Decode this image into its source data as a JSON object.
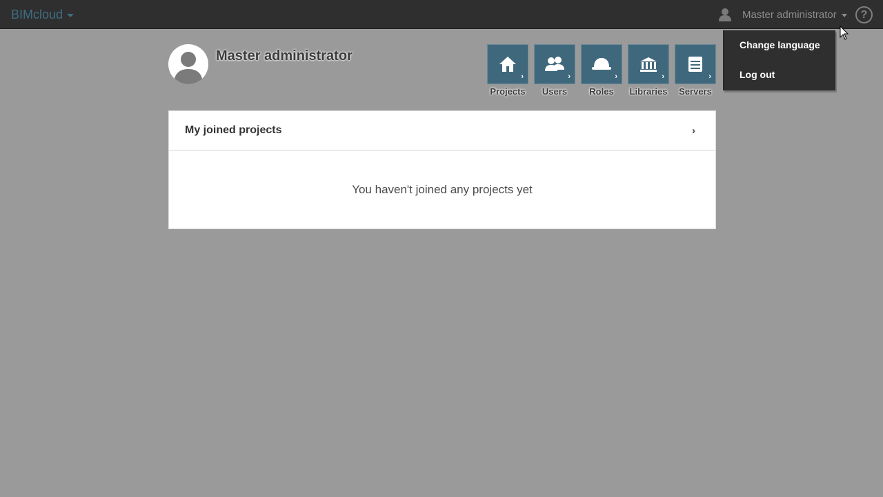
{
  "app": {
    "brand": "BIMcloud",
    "accent_color": "#3f6d82"
  },
  "topbar": {
    "user_name": "Master administrator",
    "help_glyph": "?"
  },
  "profile": {
    "name": "Master administrator",
    "avatar_icon": "user-avatar-icon"
  },
  "tiles": [
    {
      "label": "Projects",
      "icon": "house-icon"
    },
    {
      "label": "Users",
      "icon": "users-icon"
    },
    {
      "label": "Roles",
      "icon": "hardhat-icon"
    },
    {
      "label": "Libraries",
      "icon": "library-icon"
    },
    {
      "label": "Servers",
      "icon": "server-icon"
    }
  ],
  "dropdown": {
    "items": [
      "Change language",
      "Log out"
    ]
  },
  "panel": {
    "title": "My joined projects",
    "empty_message": "You haven't joined any projects yet",
    "chevron": "›"
  }
}
